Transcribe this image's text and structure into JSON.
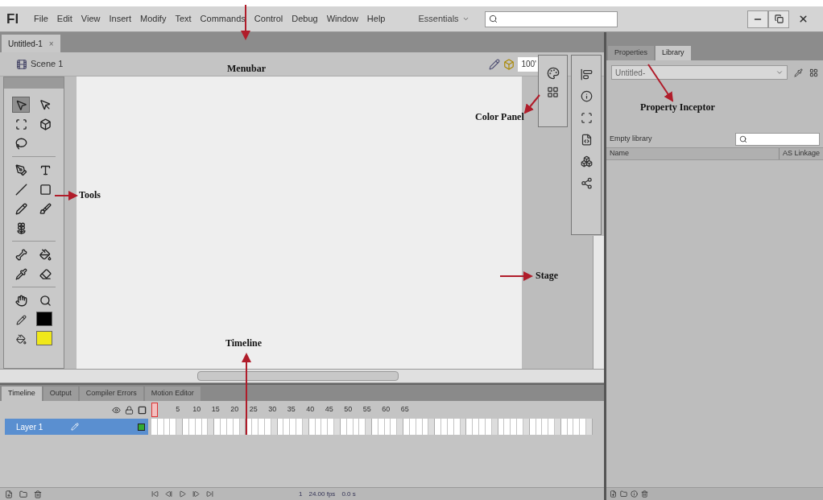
{
  "app": {
    "logo": "Fl",
    "menu": [
      "File",
      "Edit",
      "View",
      "Insert",
      "Modify",
      "Text",
      "Commands",
      "Control",
      "Debug",
      "Window",
      "Help"
    ],
    "workspace": "Essentials"
  },
  "document_tabs": [
    {
      "label": "Untitled-1",
      "close": "×",
      "selected": true
    }
  ],
  "scene": {
    "label": "Scene 1",
    "zoom": "100'"
  },
  "tools": [
    {
      "selected": true
    },
    {
      "selected": false
    },
    {
      "selected": false
    },
    {
      "selected": false
    },
    {
      "selected": false
    },
    {
      "selected": false
    },
    {
      "selected": false
    },
    {
      "selected": false
    },
    {
      "selected": false
    },
    {
      "selected": false
    },
    {
      "selected": false
    },
    {
      "selected": false
    },
    {
      "selected": false
    },
    {
      "selected": false
    },
    {
      "selected": false
    },
    {
      "selected": false
    },
    {
      "selected": false
    },
    {
      "selected": false
    }
  ],
  "swatches": [
    {
      "kind": "stroke",
      "color": "#000000"
    },
    {
      "kind": "fill",
      "color": "#f0e81a"
    }
  ],
  "timeline": {
    "tabs": [
      {
        "label": "Timeline",
        "selected": true
      },
      {
        "label": "Output",
        "selected": false
      },
      {
        "label": "Compiler Errors",
        "selected": false
      },
      {
        "label": "Motion Editor",
        "selected": false
      }
    ],
    "frame_numbers": [
      "5",
      "10",
      "15",
      "20",
      "25",
      "30",
      "35",
      "40",
      "45",
      "50",
      "55",
      "60",
      "65"
    ],
    "layers": [
      {
        "name": "Layer 1",
        "selected": true
      }
    ],
    "current_frame": "1",
    "fps": "24.00 fps",
    "time": "0.0 s"
  },
  "right_panel": {
    "tabs": [
      {
        "label": "Properties",
        "selected": false
      },
      {
        "label": "Library",
        "selected": true
      }
    ],
    "document": "Untitled-",
    "item_count": "Empty library",
    "columns": [
      "Name",
      "AS Linkage"
    ]
  },
  "annotations": [
    {
      "text": "Menubar"
    },
    {
      "text": "Tools"
    },
    {
      "text": "Color Panel"
    },
    {
      "text": "Property Inceptor"
    },
    {
      "text": "Stage"
    },
    {
      "text": "Timeline"
    }
  ]
}
